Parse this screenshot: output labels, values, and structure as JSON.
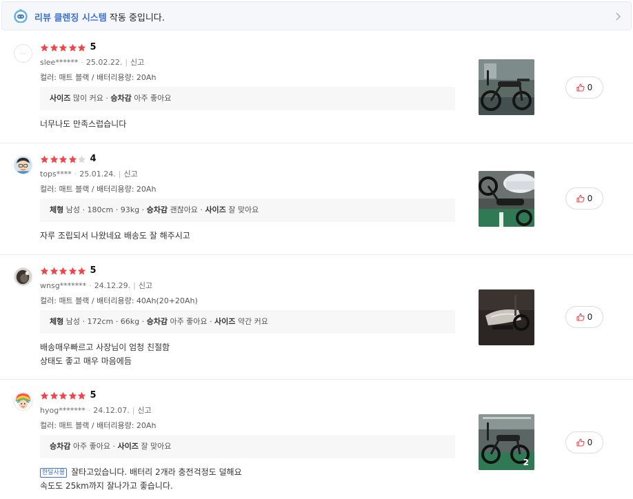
{
  "banner": {
    "highlight": "리뷰 클렌징 시스템",
    "rest": " 작동 중입니다."
  },
  "reviews": [
    {
      "rating": "5",
      "stars_filled": 5,
      "user": "slee******",
      "date": "25.02.22.",
      "report_label": "신고",
      "option": "컬러: 매트 블랙 / 배터리용량: 20Ah",
      "survey": [
        {
          "k": "사이즈",
          "v": "많이 커요"
        },
        {
          "k": "승차감",
          "v": "아주 좋아요"
        }
      ],
      "body": [
        "너무나도 만족스럽습니다"
      ],
      "likes": "0"
    },
    {
      "rating": "4",
      "stars_filled": 4,
      "user": "tops****",
      "date": "25.01.24.",
      "report_label": "신고",
      "option": "컬러: 매트 블랙 / 배터리용량: 20Ah",
      "survey": [
        {
          "k": "체형",
          "v": "남성 · 180cm · 93kg"
        },
        {
          "k": "승차감",
          "v": "괜찮아요"
        },
        {
          "k": "사이즈",
          "v": "잘 맞아요"
        }
      ],
      "body": [
        "자루 조립되서 나왔네요  배송도 잘 해주시고"
      ],
      "likes": "0"
    },
    {
      "rating": "5",
      "stars_filled": 5,
      "user": "wnsg*******",
      "date": "24.12.29.",
      "report_label": "신고",
      "option": "컬러: 매트 블랙 / 배터리용량: 40Ah(20+20Ah)",
      "survey": [
        {
          "k": "체형",
          "v": "남성 · 172cm · 66kg"
        },
        {
          "k": "승차감",
          "v": "아주 좋아요"
        },
        {
          "k": "사이즈",
          "v": "약간 커요"
        }
      ],
      "body": [
        "배송매우빠르고 사장님이 엄청 친절함",
        "상태도 좋고 매우 마음에듬"
      ],
      "likes": "0"
    },
    {
      "rating": "5",
      "stars_filled": 5,
      "user": "hyog*******",
      "date": "24.12.07.",
      "report_label": "신고",
      "option": "컬러: 매트 블랙 / 배터리용량: 20Ah",
      "survey": [
        {
          "k": "승차감",
          "v": "아주 좋아요"
        },
        {
          "k": "사이즈",
          "v": "잘 맞아요"
        }
      ],
      "badge": "한달사용",
      "body": [
        "잘타고있습니다. 배터리 2개라 충전걱정도 덜해요",
        "속도도 25km까지 잘나가고 좋습니다."
      ],
      "photo_count": "2",
      "likes": "0"
    }
  ],
  "colors": {
    "star": "#f0454a",
    "star_empty": "#d9d9d9",
    "accent": "#3d6fd6"
  }
}
